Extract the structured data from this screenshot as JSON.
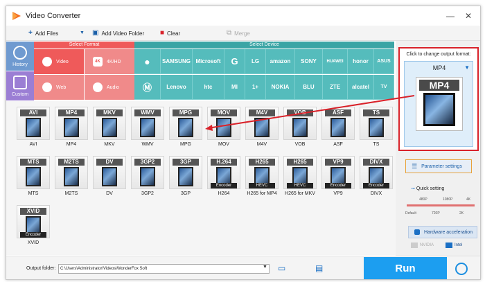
{
  "app": {
    "title": "Video Converter"
  },
  "window_controls": {
    "minimize": "—",
    "close": "✕"
  },
  "toolbar": {
    "add_files": "Add Files",
    "add_video_folder": "Add Video Folder",
    "clear": "Clear",
    "merge": "Merge"
  },
  "side": {
    "history": "History",
    "custom": "Custom"
  },
  "format_panel": {
    "header": "Select Format",
    "buttons": [
      {
        "label": "Video",
        "icon": "play-icon"
      },
      {
        "label": "4K/HD",
        "icon": "4k-icon",
        "badge": "4K"
      },
      {
        "label": "Web",
        "icon": "web-icon"
      },
      {
        "label": "Audio",
        "icon": "speaker-icon"
      }
    ]
  },
  "device_panel": {
    "header": "Select Device",
    "row1": [
      "",
      "SAMSUNG",
      "Microsoft",
      "G",
      "LG",
      "amazon",
      "SONY",
      "HUAWEI",
      "honor",
      "ASUS"
    ],
    "row2": [
      "",
      "Lenovo",
      "htc",
      "MI",
      "1+",
      "NOKIA",
      "BLU",
      "ZTE",
      "alcatel",
      "TV"
    ]
  },
  "formats": [
    {
      "label": "AVI",
      "tag": "AVI"
    },
    {
      "label": "MP4",
      "tag": "MP4"
    },
    {
      "label": "MKV",
      "tag": "MKV"
    },
    {
      "label": "WMV",
      "tag": "WMV"
    },
    {
      "label": "MPG",
      "tag": "MPG"
    },
    {
      "label": "MOV",
      "tag": "MOV"
    },
    {
      "label": "M4V",
      "tag": "M4V"
    },
    {
      "label": "VOB",
      "tag": "VOB"
    },
    {
      "label": "ASF",
      "tag": "ASF"
    },
    {
      "label": "TS",
      "tag": "TS"
    },
    {
      "label": "MTS",
      "tag": "MTS"
    },
    {
      "label": "M2TS",
      "tag": "M2TS"
    },
    {
      "label": "DV",
      "tag": "DV"
    },
    {
      "label": "3GP2",
      "tag": "3GP2"
    },
    {
      "label": "3GP",
      "tag": "3GP"
    },
    {
      "label": "H264",
      "tag": "H.264",
      "sub": "Encoder"
    },
    {
      "label": "H265 for MP4",
      "tag": "H265",
      "sub": "HEVC"
    },
    {
      "label": "H265 for MKV",
      "tag": "H265",
      "sub": "HEVC"
    },
    {
      "label": "VP9",
      "tag": "VP9",
      "sub": "Encoder"
    },
    {
      "label": "DIVX",
      "tag": "DIVX",
      "sub": "Encoder"
    },
    {
      "label": "XVID",
      "tag": "XVID",
      "sub": "Encoder"
    }
  ],
  "output": {
    "caption": "Click to change output format:",
    "selected": "MP4",
    "icon_tag": "MP4"
  },
  "settings": {
    "parameter": "Parameter settings",
    "quick": "Quick setting",
    "ticks_top": [
      "480P",
      "1080P",
      "4K"
    ],
    "ticks_bottom": [
      "Default",
      "720P",
      "2K"
    ],
    "hw": "Hardware acceleration",
    "nvidia": "NVIDIA",
    "intel": "Intel"
  },
  "bottom": {
    "output_folder_label": "Output folder:",
    "output_folder_value": "C:\\Users\\Administrator\\Videos\\WonderFox Soft",
    "run": "Run"
  },
  "colors": {
    "accent": "#1c9ef0",
    "highlight": "#d9222a",
    "format_red": "#ef5a5a",
    "device_teal": "#55bcbc"
  }
}
